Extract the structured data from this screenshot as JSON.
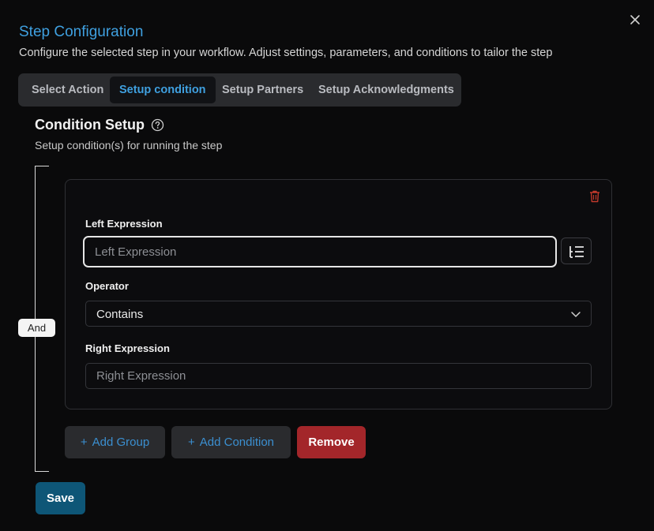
{
  "dialog": {
    "title": "Step Configuration",
    "subtitle": "Configure the selected step in your workflow. Adjust settings, parameters, and conditions to tailor the step"
  },
  "tabs": [
    {
      "label": "Select Action",
      "active": false
    },
    {
      "label": "Setup condition",
      "active": true
    },
    {
      "label": "Setup Partners",
      "active": false
    },
    {
      "label": "Setup Acknowledgments",
      "active": false
    }
  ],
  "section": {
    "title": "Condition Setup",
    "subtitle": "Setup condition(s) for running the step"
  },
  "group": {
    "logic_label": "And"
  },
  "condition": {
    "left_label": "Left Expression",
    "left_placeholder": "Left Expression",
    "left_value": "",
    "operator_label": "Operator",
    "operator_value": "Contains",
    "right_label": "Right Expression",
    "right_placeholder": "Right Expression",
    "right_value": ""
  },
  "actions": {
    "add_group": "Add Group",
    "add_condition": "Add Condition",
    "remove": "Remove",
    "save": "Save"
  },
  "colors": {
    "accent": "#3fa0e0",
    "danger": "#a3262a",
    "primary": "#0e5677"
  },
  "icons": {
    "close": "close-icon",
    "help": "help-circle-icon",
    "delete": "trash-icon",
    "expression_builder": "expression-list-icon",
    "dropdown": "chevron-down-icon",
    "add": "plus-icon"
  }
}
